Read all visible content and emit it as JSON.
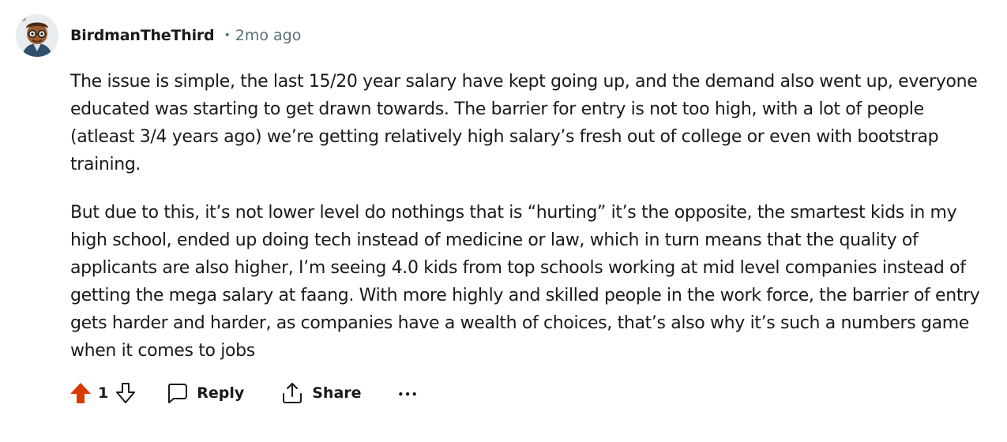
{
  "comment": {
    "author": "BirdmanTheThird",
    "separator": "•",
    "timestamp": "2mo ago",
    "paragraphs": [
      "The issue is simple, the last 15/20 year salary have kept going up, and the demand also went up, everyone educated was starting to get drawn towards. The barrier for entry is not too high, with a lot of people (atleast 3/4 years ago) we’re getting relatively high salary’s fresh out of college or even with bootstrap training.",
      "But due to this, it’s not lower level do nothings that is “hurting” it’s the opposite, the smartest kids in my high school, ended up doing tech instead of medicine or law, which in turn means that the quality of applicants are also higher, I’m seeing 4.0 kids from top schools working at mid level companies instead of getting the mega salary at faang. With more highly and skilled people in the work force, the barrier of entry gets harder and harder, as companies have a wealth of choices, that’s also why it’s such a numbers game when it comes to jobs"
    ]
  },
  "actions": {
    "vote_count": "1",
    "reply_label": "Reply",
    "share_label": "Share",
    "more_label": "•••"
  },
  "icons": {
    "upvote": "upvote-arrow-icon",
    "downvote": "downvote-arrow-icon",
    "reply": "speech-bubble-icon",
    "share": "share-upload-icon",
    "more": "ellipsis-icon"
  },
  "colors": {
    "upvote_active": "#d93a00",
    "text": "#1a1a1b",
    "meta": "#576f76"
  }
}
